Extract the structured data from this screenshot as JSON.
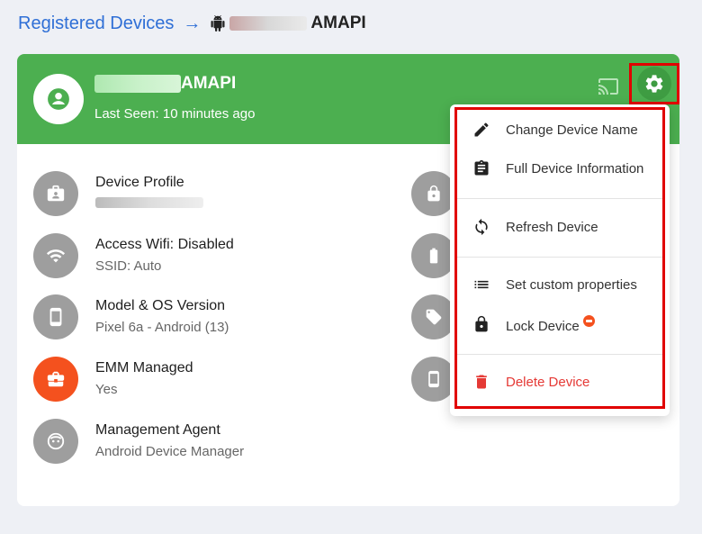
{
  "breadcrumb": {
    "link": "Registered Devices",
    "arrow": "→",
    "device_suffix": "AMAPI"
  },
  "header": {
    "device_suffix": "AMAPI",
    "last_seen": "Last Seen: 10 minutes ago",
    "icons": [
      "account-icon",
      "cast-icon",
      "gear-icon"
    ]
  },
  "items": [
    {
      "title": "Device Profile",
      "sub": "",
      "icon": "briefcase-account-icon"
    },
    {
      "title": "Access Wifi: Disabled",
      "sub": "SSID: Auto",
      "icon": "wifi-icon"
    },
    {
      "title": "Model & OS Version",
      "sub": "Pixel 6a - Android (13)",
      "icon": "phone-icon"
    },
    {
      "title": "EMM Managed",
      "sub": "Yes",
      "icon": "briefcase-icon"
    },
    {
      "title": "Management Agent",
      "sub": "Android Device Manager",
      "icon": "agent-face-icon"
    }
  ],
  "menu": {
    "change_name": "Change Device Name",
    "full_info": "Full Device Information",
    "refresh": "Refresh Device",
    "custom_props": "Set custom properties",
    "lock": "Lock Device",
    "delete": "Delete Device"
  },
  "colors": {
    "header_green": "#4caf50",
    "link_blue": "#2f6fd6",
    "danger_red": "#e53935",
    "highlight_red": "#e10000",
    "emm_orange": "#f4511e"
  }
}
